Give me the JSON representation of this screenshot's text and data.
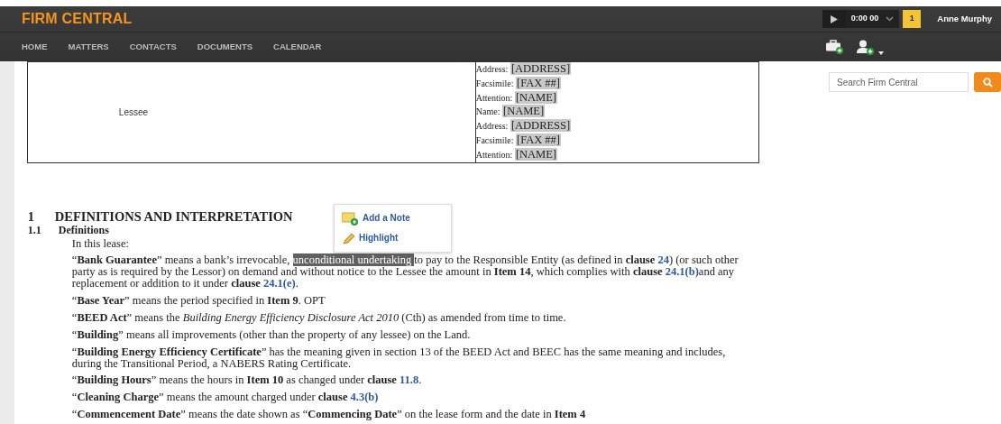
{
  "header": {
    "brand": "FIRM CENTRAL",
    "timer": "0:00 00",
    "notification_count": "1",
    "user": "Anne Murphy",
    "nav": [
      {
        "label": "HOME"
      },
      {
        "label": "MATTERS"
      },
      {
        "label": "CONTACTS"
      },
      {
        "label": "DOCUMENTS"
      },
      {
        "label": "CALENDAR"
      }
    ]
  },
  "lease_table": {
    "party": "Lessee",
    "details": [
      {
        "label": "Address:",
        "value": "[ADDRESS]"
      },
      {
        "label": "Facsimile:",
        "value": "[FAX ##]"
      },
      {
        "label": "Attention:",
        "value": "[NAME]"
      },
      {
        "label": "Name:",
        "value": "[NAME]"
      },
      {
        "label": "Address:",
        "value": "[ADDRESS]"
      },
      {
        "label": "Facsimile:",
        "value": "[FAX ##]"
      },
      {
        "label": "Attention:",
        "value": "[NAME]"
      }
    ]
  },
  "document": {
    "section": {
      "number": "1",
      "title": "DEFINITIONS AND INTERPRETATION"
    },
    "subsection": {
      "number": "1.1",
      "title": "Definitions"
    },
    "paragraphs": [
      [
        {
          "kind": "plain",
          "text": "In this lease:"
        }
      ],
      [
        {
          "kind": "plain",
          "text": "“"
        },
        {
          "kind": "bold",
          "text": "Bank Guarantee"
        },
        {
          "kind": "plain",
          "text": "” means a bank’s irrevocable, "
        },
        {
          "kind": "selected",
          "text": "unconditional undertaking "
        },
        {
          "kind": "plain",
          "text": "to pay to the Responsible Entity (as defined in "
        },
        {
          "kind": "bold",
          "text": "clause "
        },
        {
          "kind": "link",
          "text": "24"
        },
        {
          "kind": "plain",
          "text": ") (or such other party as is required by the Lessor)  on demand and without notice to the Lessee the amount in "
        },
        {
          "kind": "bold",
          "text": "Item 14"
        },
        {
          "kind": "plain",
          "text": ", which complies with "
        },
        {
          "kind": "bold",
          "text": "clause "
        },
        {
          "kind": "link",
          "text": "24.1(b)"
        },
        {
          "kind": "plain",
          "text": "and any replacement or addition to it under "
        },
        {
          "kind": "bold",
          "text": "clause "
        },
        {
          "kind": "link",
          "text": "24.1(e)"
        },
        {
          "kind": "plain",
          "text": "."
        }
      ],
      [
        {
          "kind": "plain",
          "text": " “"
        },
        {
          "kind": "bold",
          "text": "Base Year"
        },
        {
          "kind": "plain",
          "text": "” means the period specified in "
        },
        {
          "kind": "bold",
          "text": "Item 9"
        },
        {
          "kind": "plain",
          "text": ". OPT"
        }
      ],
      [
        {
          "kind": "plain",
          "text": "“"
        },
        {
          "kind": "bold",
          "text": "BEED Act"
        },
        {
          "kind": "plain",
          "text": "” means the "
        },
        {
          "kind": "italic",
          "text": "Building Energy Efficiency Disclosure Act 2010"
        },
        {
          "kind": "plain",
          "text": " (Cth) as amended from time to time."
        }
      ],
      [
        {
          "kind": "plain",
          "text": "“"
        },
        {
          "kind": "bold",
          "text": "Building"
        },
        {
          "kind": "plain",
          "text": "” means all improvements (other than the property of any lessee) on the Land."
        }
      ],
      [
        {
          "kind": "plain",
          "text": "“"
        },
        {
          "kind": "bold",
          "text": "Building Energy Efficiency Certificate"
        },
        {
          "kind": "plain",
          "text": "” has the meaning given in section 13 of the BEED Act and BEEC has the same meaning and includes, during the Transitional Period, a NABERS Rating Certificate."
        }
      ],
      [
        {
          "kind": "plain",
          "text": "“"
        },
        {
          "kind": "bold",
          "text": "Building Hours"
        },
        {
          "kind": "plain",
          "text": "” means the hours in "
        },
        {
          "kind": "bold",
          "text": "Item 10"
        },
        {
          "kind": "plain",
          "text": " as changed under "
        },
        {
          "kind": "bold",
          "text": "clause "
        },
        {
          "kind": "link",
          "text": "11.8"
        },
        {
          "kind": "plain",
          "text": "."
        }
      ],
      [
        {
          "kind": "plain",
          "text": "“"
        },
        {
          "kind": "bold",
          "text": "Cleaning Charge"
        },
        {
          "kind": "plain",
          "text": "” means the amount charged under "
        },
        {
          "kind": "bold",
          "text": "clause "
        },
        {
          "kind": "link",
          "text": "4.3(b)"
        }
      ],
      [
        {
          "kind": "plain",
          "text": "“"
        },
        {
          "kind": "bold",
          "text": "Commencement Date"
        },
        {
          "kind": "plain",
          "text": "” means the date shown as “"
        },
        {
          "kind": "bold",
          "text": "Commencing Date"
        },
        {
          "kind": "plain",
          "text": "” on the lease form and the date in "
        },
        {
          "kind": "bold",
          "text": "Item 4"
        }
      ]
    ]
  },
  "context_menu": {
    "items": [
      {
        "kind": "note",
        "label": "Add a Note"
      },
      {
        "kind": "highlight",
        "label": "Highlight"
      }
    ]
  },
  "search": {
    "placeholder": "Search Firm Central"
  }
}
